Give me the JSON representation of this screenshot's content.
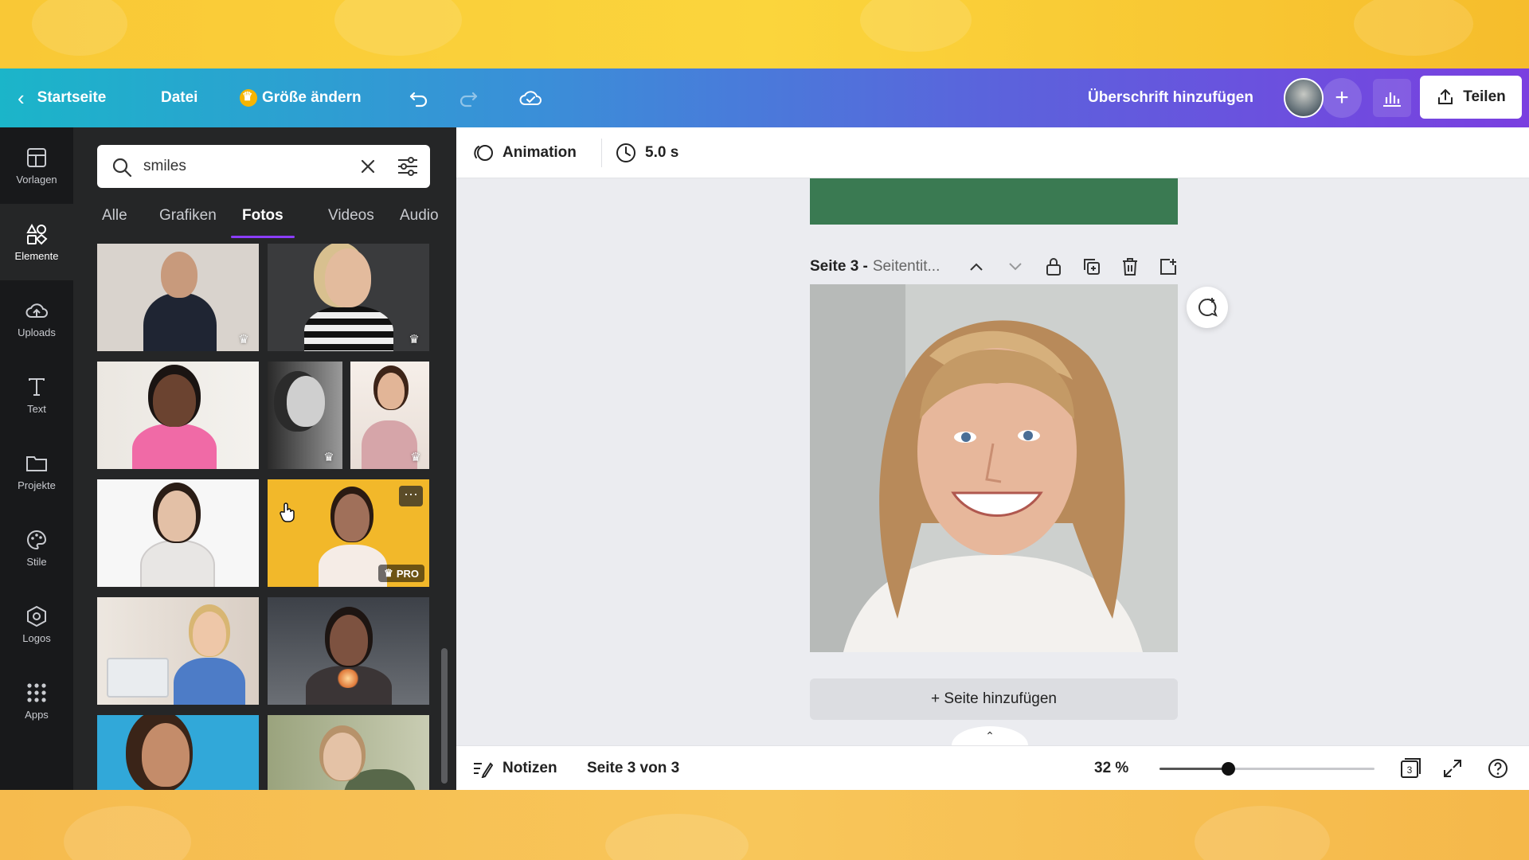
{
  "topbar": {
    "home": "Startseite",
    "file": "Datei",
    "resize": "Größe ändern",
    "add_title": "Überschrift hinzufügen",
    "share": "Teilen"
  },
  "rail": [
    {
      "label": "Vorlagen",
      "icon": "templates-icon"
    },
    {
      "label": "Elemente",
      "icon": "elements-icon",
      "active": true
    },
    {
      "label": "Uploads",
      "icon": "upload-icon"
    },
    {
      "label": "Text",
      "icon": "text-icon"
    },
    {
      "label": "Projekte",
      "icon": "folder-icon"
    },
    {
      "label": "Stile",
      "icon": "palette-icon"
    },
    {
      "label": "Logos",
      "icon": "logo-icon"
    },
    {
      "label": "Apps",
      "icon": "apps-icon"
    }
  ],
  "panel": {
    "search_value": "smiles",
    "tabs": [
      "Alle",
      "Grafiken",
      "Fotos",
      "Videos",
      "Audio"
    ],
    "active_tab": "Fotos",
    "pro_label": "PRO"
  },
  "context_bar": {
    "animation": "Animation",
    "duration": "5.0 s"
  },
  "page": {
    "title_bold": "Seite 3 -",
    "title_sub": "Seitentit..."
  },
  "add_page": "+ Seite hinzufügen",
  "bottombar": {
    "notes": "Notizen",
    "page_counter": "Seite 3 von 3",
    "zoom": "32 %",
    "zoom_level": 0.32,
    "pages_badge": "3"
  },
  "colors": {
    "accent": "#8b3dff",
    "panel_bg": "#252627",
    "rail_bg": "#18191b",
    "canvas_bg": "#ebecf0"
  }
}
